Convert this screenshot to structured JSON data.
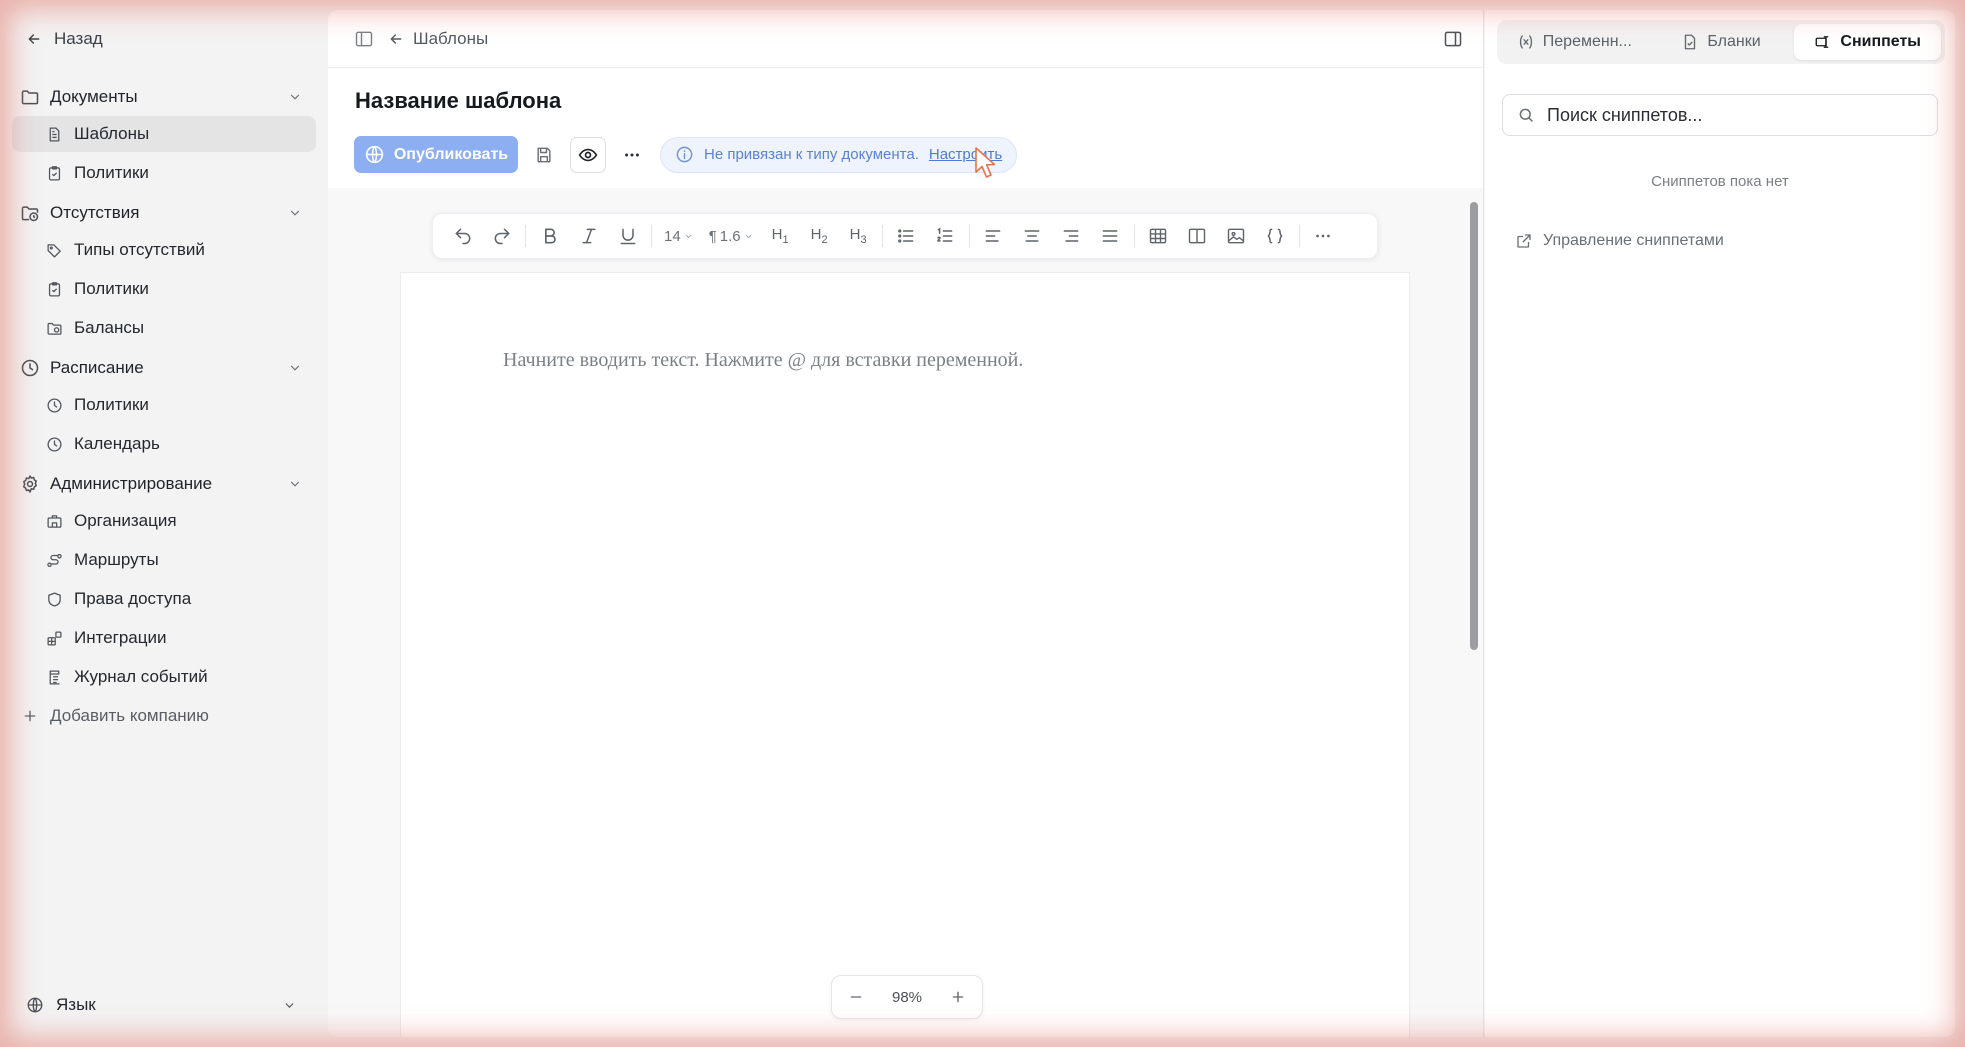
{
  "sidebar": {
    "back_label": "Назад",
    "sections": [
      {
        "label": "Документы",
        "icon": "folder-icon",
        "items": [
          {
            "label": "Шаблоны",
            "icon": "file-text-icon",
            "active": true
          },
          {
            "label": "Политики",
            "icon": "clipboard-check-icon",
            "active": false
          }
        ]
      },
      {
        "label": "Отсутствия",
        "icon": "calendar-clock-icon",
        "items": [
          {
            "label": "Типы отсутствий",
            "icon": "tags-icon",
            "active": false
          },
          {
            "label": "Политики",
            "icon": "clipboard-check-icon",
            "active": false
          },
          {
            "label": "Балансы",
            "icon": "folder-clock-icon",
            "active": false
          }
        ]
      },
      {
        "label": "Расписание",
        "icon": "clock-icon",
        "items": [
          {
            "label": "Политики",
            "icon": "clock-icon",
            "active": false
          },
          {
            "label": "Календарь",
            "icon": "clock-icon",
            "active": false
          }
        ]
      },
      {
        "label": "Администрирование",
        "icon": "gear-icon",
        "items": [
          {
            "label": "Организация",
            "icon": "building-icon",
            "active": false
          },
          {
            "label": "Маршруты",
            "icon": "route-icon",
            "active": false
          },
          {
            "label": "Права доступа",
            "icon": "shield-icon",
            "active": false
          },
          {
            "label": "Интеграции",
            "icon": "blocks-icon",
            "active": false
          },
          {
            "label": "Журнал событий",
            "icon": "log-icon",
            "active": false
          }
        ]
      }
    ],
    "add_company_label": "Добавить компанию",
    "language_label": "Язык"
  },
  "header": {
    "breadcrumb": "Шаблоны"
  },
  "document": {
    "title": "Название шаблона",
    "publish_label": "Опубликовать",
    "info_text": "Не привязан к типу документа.",
    "info_link": "Настроить",
    "placeholder": "Начните вводить текст. Нажмите @ для вставки переменной."
  },
  "toolbar": {
    "font_size": "14",
    "line_height": "1.6",
    "h1": "H",
    "h1_sub": "1",
    "h2": "H",
    "h2_sub": "2",
    "h3": "H",
    "h3_sub": "3"
  },
  "zoom": {
    "value": "98%"
  },
  "right_panel": {
    "tabs": [
      {
        "label": "Переменн...",
        "icon": "variable-icon",
        "active": false
      },
      {
        "label": "Бланки",
        "icon": "file-form-icon",
        "active": false
      },
      {
        "label": "Сниппеты",
        "icon": "snippet-icon",
        "active": true
      }
    ],
    "search_placeholder": "Поиск сниппетов...",
    "empty_text": "Сниппетов пока нет",
    "manage_label": "Управление сниппетами"
  },
  "colors": {
    "accent": "#8daef0",
    "info_bg": "#eef3fd",
    "info_text": "#5a82d4",
    "active_item_bg": "#e4e4e5"
  }
}
